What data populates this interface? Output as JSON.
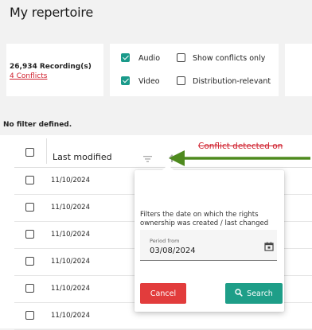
{
  "page": {
    "title": "My repertoire"
  },
  "summary": {
    "recordings": "26,934 Recording(s)",
    "conflicts": "4 Conflicts"
  },
  "filters": [
    {
      "label": "Audio",
      "checked": true
    },
    {
      "label": "Show conflicts only",
      "checked": false
    },
    {
      "label": "Video",
      "checked": true
    },
    {
      "label": "Distribution-relevant",
      "checked": false
    }
  ],
  "filter_status": "No filter defined.",
  "table": {
    "header": {
      "last_modified": "Last modified",
      "conflict": "Conflict detected on"
    },
    "rows": [
      "11/10/2024",
      "11/10/2024",
      "11/10/2024",
      "11/10/2024",
      "11/10/2024",
      "11/10/2024"
    ]
  },
  "popover": {
    "description": "Filters the date on which the rights ownership was created / last changed",
    "field_label": "Period from",
    "field_value": "03/08/2024",
    "cancel_label": "Cancel",
    "search_label": "Search"
  },
  "colors": {
    "accent": "#1e9e88",
    "danger": "#e23c3c",
    "annotation_arrow": "#4e8a1e"
  }
}
